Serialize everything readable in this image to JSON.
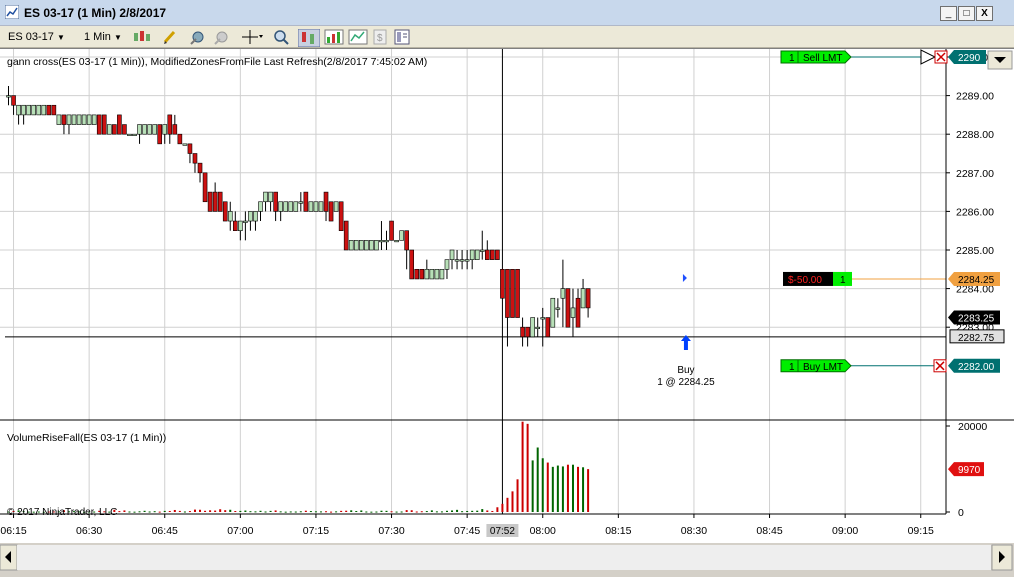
{
  "window": {
    "title": "ES 03-17 (1 Min)  2/8/2017",
    "min_label": "_",
    "max_label": "□",
    "close_label": "X"
  },
  "toolbar": {
    "instrument": "ES 03-17",
    "interval": "1 Min"
  },
  "price_panel": {
    "header": "gann cross(ES 03-17 (1 Min)), ModifiedZonesFromFile Last Refresh(2/8/2017 7:45:02 AM)",
    "y_ticks": [
      "2290.00",
      "2289.00",
      "2288.00",
      "2287.00",
      "2286.00",
      "2285.00",
      "2284.00",
      "2283.00"
    ],
    "price_markers": {
      "sell_limit_price": "2290",
      "position_avg_price": "2284.25",
      "last_price": "2283.25",
      "crosshair_price": "2282.75",
      "buy_limit_price": "2282.00"
    },
    "orders": {
      "sell_qty": "1",
      "sell_label": "Sell LMT",
      "pnl": "$-50.00",
      "pnl_qty": "1",
      "buy_qty": "1",
      "buy_label": "Buy LMT"
    },
    "execution": {
      "label": "Buy",
      "detail": "1 @ 2284.25"
    }
  },
  "volume_panel": {
    "header": "VolumeRiseFall(ES 03-17 (1 Min))",
    "y_ticks": [
      "20000",
      "0"
    ],
    "last_volume": "9970",
    "copyright": "© 2017 NinjaTrader, LLC"
  },
  "x_axis": {
    "labels": [
      "06:15",
      "06:30",
      "06:45",
      "07:00",
      "07:15",
      "07:30",
      "07:45",
      "08:00",
      "08:15",
      "08:30",
      "08:45",
      "09:00",
      "09:15"
    ],
    "crosshair_time": "07:52"
  },
  "colors": {
    "up_candle": "#b8e0b8",
    "down_candle": "#cc1111",
    "volume_up": "#006400",
    "volume_down": "#cc0000",
    "order_green": "#00ee00",
    "price_box_teal": "#007070",
    "position_line": "#f0a040"
  },
  "chart_data": {
    "type": "candlestick",
    "xlabel": "",
    "ylabel": "",
    "ylim": [
      2282.25,
      2290.25
    ],
    "volume_ylim": [
      0,
      22000
    ],
    "time_start": "06:14",
    "time_step_minutes": 1,
    "candles": [
      [
        2289.0,
        2289.25,
        2288.75,
        2289.0,
        100
      ],
      [
        2289.0,
        2289.0,
        2288.5,
        2288.75,
        250
      ],
      [
        2288.5,
        2288.75,
        2288.25,
        2288.75,
        380
      ],
      [
        2288.5,
        2288.75,
        2288.25,
        2288.75,
        200
      ],
      [
        2288.5,
        2288.75,
        2288.5,
        2288.75,
        90
      ],
      [
        2288.5,
        2288.75,
        2288.5,
        2288.75,
        80
      ],
      [
        2288.5,
        2288.75,
        2288.5,
        2288.75,
        110
      ],
      [
        2288.5,
        2288.75,
        2288.5,
        2288.75,
        60
      ],
      [
        2288.75,
        2288.75,
        2288.5,
        2288.5,
        110
      ],
      [
        2288.75,
        2288.75,
        2288.5,
        2288.5,
        130
      ],
      [
        2288.25,
        2288.5,
        2288.25,
        2288.5,
        150
      ],
      [
        2288.5,
        2288.5,
        2288.0,
        2288.25,
        420
      ],
      [
        2288.25,
        2288.5,
        2288.0,
        2288.5,
        160
      ],
      [
        2288.25,
        2288.5,
        2288.25,
        2288.5,
        200
      ],
      [
        2288.25,
        2288.5,
        2288.25,
        2288.5,
        130
      ],
      [
        2288.25,
        2288.5,
        2288.25,
        2288.5,
        60
      ],
      [
        2288.25,
        2288.5,
        2288.25,
        2288.5,
        90
      ],
      [
        2288.25,
        2288.5,
        2288.25,
        2288.5,
        110
      ],
      [
        2288.5,
        2288.5,
        2288.0,
        2288.0,
        280
      ],
      [
        2288.5,
        2288.5,
        2288.0,
        2288.0,
        160
      ],
      [
        2288.0,
        2288.25,
        2288.0,
        2288.25,
        90
      ],
      [
        2288.25,
        2288.25,
        2288.0,
        2288.0,
        520
      ],
      [
        2288.5,
        2288.5,
        2288.0,
        2288.0,
        210
      ],
      [
        2288.25,
        2288.25,
        2288.0,
        2288.0,
        370
      ],
      [
        2288.0,
        2288.0,
        2288.0,
        2288.0,
        120
      ],
      [
        2288.0,
        2288.0,
        2288.0,
        2288.0,
        80
      ],
      [
        2288.0,
        2288.25,
        2287.75,
        2288.25,
        160
      ],
      [
        2288.0,
        2288.25,
        2288.0,
        2288.25,
        280
      ],
      [
        2288.0,
        2288.25,
        2288.0,
        2288.25,
        120
      ],
      [
        2288.0,
        2288.25,
        2288.0,
        2288.25,
        190
      ],
      [
        2288.25,
        2288.25,
        2287.75,
        2287.75,
        90
      ],
      [
        2288.0,
        2288.25,
        2287.75,
        2288.25,
        260
      ],
      [
        2288.5,
        2288.5,
        2287.75,
        2288.0,
        240
      ],
      [
        2288.25,
        2288.5,
        2288.0,
        2288.0,
        470
      ],
      [
        2288.0,
        2288.0,
        2287.75,
        2287.75,
        260
      ],
      [
        2287.75,
        2287.75,
        2287.75,
        2287.75,
        120
      ],
      [
        2287.75,
        2287.75,
        2287.25,
        2287.5,
        220
      ],
      [
        2287.5,
        2287.5,
        2287.0,
        2287.25,
        560
      ],
      [
        2287.25,
        2287.25,
        2286.75,
        2287.0,
        520
      ],
      [
        2287.0,
        2287.0,
        2286.25,
        2286.25,
        280
      ],
      [
        2286.5,
        2286.5,
        2286.0,
        2286.0,
        400
      ],
      [
        2286.5,
        2286.75,
        2286.0,
        2286.0,
        330
      ],
      [
        2286.5,
        2286.5,
        2286.0,
        2286.0,
        640
      ],
      [
        2286.25,
        2286.25,
        2285.75,
        2285.75,
        420
      ],
      [
        2285.75,
        2286.25,
        2285.5,
        2286.0,
        520
      ],
      [
        2285.75,
        2286.0,
        2285.5,
        2285.5,
        230
      ],
      [
        2285.5,
        2285.75,
        2285.25,
        2285.75,
        260
      ],
      [
        2285.75,
        2286.0,
        2285.25,
        2285.75,
        340
      ],
      [
        2285.75,
        2286.0,
        2285.5,
        2286.0,
        190
      ],
      [
        2285.75,
        2286.0,
        2285.5,
        2286.0,
        150
      ],
      [
        2286.0,
        2286.25,
        2285.75,
        2286.25,
        280
      ],
      [
        2286.25,
        2286.5,
        2286.0,
        2286.5,
        120
      ],
      [
        2286.25,
        2286.5,
        2286.0,
        2286.5,
        260
      ],
      [
        2286.5,
        2286.5,
        2285.75,
        2286.0,
        360
      ],
      [
        2286.0,
        2286.25,
        2285.75,
        2286.25,
        150
      ],
      [
        2286.0,
        2286.25,
        2286.0,
        2286.25,
        80
      ],
      [
        2286.0,
        2286.25,
        2286.0,
        2286.25,
        130
      ],
      [
        2286.0,
        2286.25,
        2286.0,
        2286.25,
        110
      ],
      [
        2286.25,
        2286.5,
        2286.0,
        2286.25,
        170
      ],
      [
        2286.5,
        2286.5,
        2286.0,
        2286.0,
        300
      ],
      [
        2286.0,
        2286.25,
        2286.0,
        2286.25,
        220
      ],
      [
        2286.0,
        2286.25,
        2286.0,
        2286.25,
        160
      ],
      [
        2286.0,
        2286.25,
        2286.0,
        2286.25,
        140
      ],
      [
        2286.5,
        2286.5,
        2285.75,
        2286.0,
        180
      ],
      [
        2286.25,
        2286.25,
        2285.75,
        2285.75,
        90
      ],
      [
        2286.0,
        2286.25,
        2286.0,
        2286.25,
        150
      ],
      [
        2286.25,
        2286.25,
        2285.5,
        2285.5,
        270
      ],
      [
        2285.75,
        2285.75,
        2285.0,
        2285.0,
        300
      ],
      [
        2285.0,
        2285.25,
        2285.0,
        2285.25,
        390
      ],
      [
        2285.0,
        2285.25,
        2285.0,
        2285.25,
        230
      ],
      [
        2285.0,
        2285.25,
        2285.0,
        2285.25,
        360
      ],
      [
        2285.0,
        2285.25,
        2285.0,
        2285.25,
        120
      ],
      [
        2285.0,
        2285.25,
        2285.0,
        2285.25,
        80
      ],
      [
        2285.0,
        2285.25,
        2285.0,
        2285.25,
        110
      ],
      [
        2285.25,
        2285.75,
        2285.0,
        2285.25,
        300
      ],
      [
        2285.25,
        2285.5,
        2285.0,
        2285.25,
        270
      ],
      [
        2285.75,
        2285.75,
        2285.25,
        2285.25,
        170
      ],
      [
        2285.25,
        2285.25,
        2285.25,
        2285.25,
        100
      ],
      [
        2285.25,
        2285.5,
        2285.25,
        2285.5,
        120
      ],
      [
        2285.5,
        2285.5,
        2284.5,
        2285.0,
        440
      ],
      [
        2285.0,
        2285.0,
        2284.25,
        2284.25,
        410
      ],
      [
        2284.5,
        2284.5,
        2284.25,
        2284.25,
        120
      ],
      [
        2284.5,
        2284.5,
        2284.25,
        2284.25,
        180
      ],
      [
        2284.25,
        2284.75,
        2284.25,
        2284.5,
        220
      ],
      [
        2284.25,
        2284.5,
        2284.25,
        2284.5,
        380
      ],
      [
        2284.25,
        2284.5,
        2284.25,
        2284.5,
        150
      ],
      [
        2284.25,
        2284.5,
        2284.25,
        2284.5,
        140
      ],
      [
        2284.5,
        2284.75,
        2284.25,
        2284.75,
        280
      ],
      [
        2284.75,
        2285.0,
        2284.5,
        2285.0,
        360
      ],
      [
        2284.75,
        2285.0,
        2284.5,
        2284.75,
        500
      ],
      [
        2284.75,
        2285.0,
        2284.5,
        2284.75,
        190
      ],
      [
        2284.75,
        2285.0,
        2284.5,
        2284.75,
        240
      ],
      [
        2284.75,
        2285.0,
        2284.5,
        2285.0,
        280
      ],
      [
        2284.75,
        2285.0,
        2284.75,
        2285.0,
        310
      ],
      [
        2285.0,
        2285.5,
        2284.75,
        2285.0,
        680
      ],
      [
        2285.0,
        2285.25,
        2284.75,
        2284.75,
        360
      ],
      [
        2285.0,
        2285.0,
        2284.75,
        2284.75,
        240
      ],
      [
        2285.0,
        2285.0,
        2284.75,
        2284.75,
        1100
      ],
      [
        2284.5,
        2284.5,
        2283.75,
        2283.75,
        1900
      ],
      [
        2284.5,
        2284.5,
        2282.5,
        2283.25,
        3300
      ],
      [
        2284.5,
        2284.5,
        2283.25,
        2283.25,
        4800
      ],
      [
        2284.5,
        2284.5,
        2283.25,
        2283.25,
        7600
      ],
      [
        2283.0,
        2283.25,
        2282.5,
        2282.75,
        21000
      ],
      [
        2283.0,
        2283.0,
        2282.5,
        2282.75,
        20500
      ],
      [
        2282.75,
        2283.25,
        2282.75,
        2283.25,
        12000
      ],
      [
        2283.0,
        2283.25,
        2282.75,
        2283.0,
        15000
      ],
      [
        2283.25,
        2283.5,
        2282.5,
        2283.25,
        12500
      ],
      [
        2283.25,
        2283.25,
        2282.75,
        2282.75,
        11500
      ],
      [
        2283.0,
        2283.75,
        2283.0,
        2283.75,
        10500
      ],
      [
        2283.5,
        2283.75,
        2283.25,
        2283.5,
        10800
      ],
      [
        2283.75,
        2284.75,
        2283.0,
        2284.0,
        10600
      ],
      [
        2284.0,
        2284.0,
        2283.0,
        2283.0,
        11000
      ],
      [
        2283.25,
        2284.0,
        2282.75,
        2283.5,
        11000
      ],
      [
        2283.75,
        2284.0,
        2283.0,
        2283.0,
        10500
      ],
      [
        2283.5,
        2284.25,
        2283.5,
        2284.0,
        10400
      ],
      [
        2284.0,
        2284.0,
        2283.25,
        2283.5,
        9970
      ]
    ],
    "order_levels": {
      "sell_limit": 2290.0,
      "buy_limit": 2282.0,
      "position": 2284.25,
      "crosshair_price": 2282.75,
      "crosshair_time": "07:52",
      "execution_time": "08:30",
      "execution_price": 2284.25
    }
  }
}
